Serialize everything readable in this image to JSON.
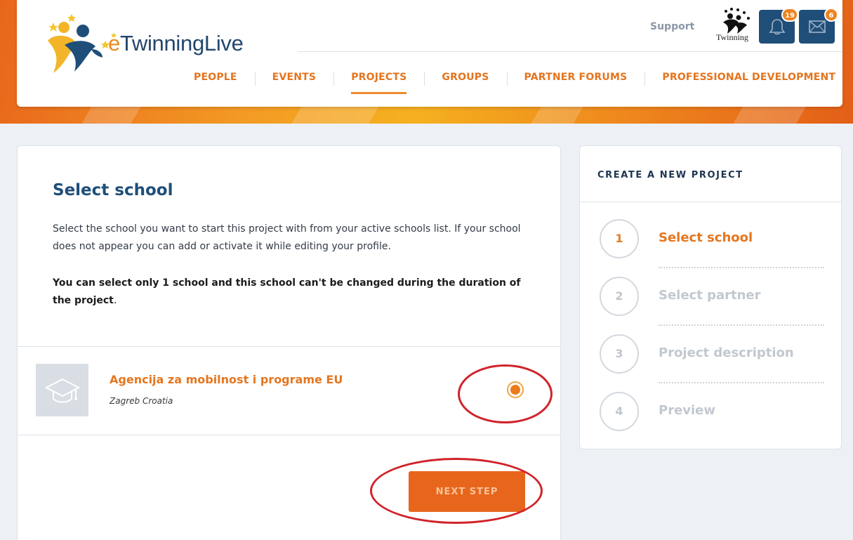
{
  "header": {
    "logo_prefix": "e",
    "logo_main": "Twinning",
    "logo_suffix": "Live",
    "support_label": "Support",
    "twinning_label": "Twinning",
    "notifications_count": "19",
    "messages_count": "6"
  },
  "nav": {
    "items": [
      {
        "label": "PEOPLE"
      },
      {
        "label": "EVENTS"
      },
      {
        "label": "PROJECTS",
        "active": true
      },
      {
        "label": "GROUPS"
      },
      {
        "label": "PARTNER FORUMS"
      },
      {
        "label": "PROFESSIONAL DEVELOPMENT"
      }
    ]
  },
  "main": {
    "title": "Select school",
    "description": "Select the school you want to start this project with from your active schools list. If your school does not appear you can add or activate it while editing your profile.",
    "note_bold": "You can select only 1 school and this school can't be changed during the duration of the project",
    "note_end": ".",
    "school": {
      "name": "Agencija za mobilnost i programe EU",
      "location": "Zagreb Croatia",
      "selected": true
    },
    "next_button": "NEXT STEP"
  },
  "sidebar": {
    "title": "CREATE A NEW PROJECT",
    "steps": [
      {
        "number": "1",
        "label": "Select school",
        "active": true
      },
      {
        "number": "2",
        "label": "Select partner"
      },
      {
        "number": "3",
        "label": "Project description"
      },
      {
        "number": "4",
        "label": "Preview"
      }
    ]
  },
  "colors": {
    "brand_orange": "#e5761f",
    "brand_blue": "#1f4e79",
    "annotation_red": "#d0232a"
  }
}
